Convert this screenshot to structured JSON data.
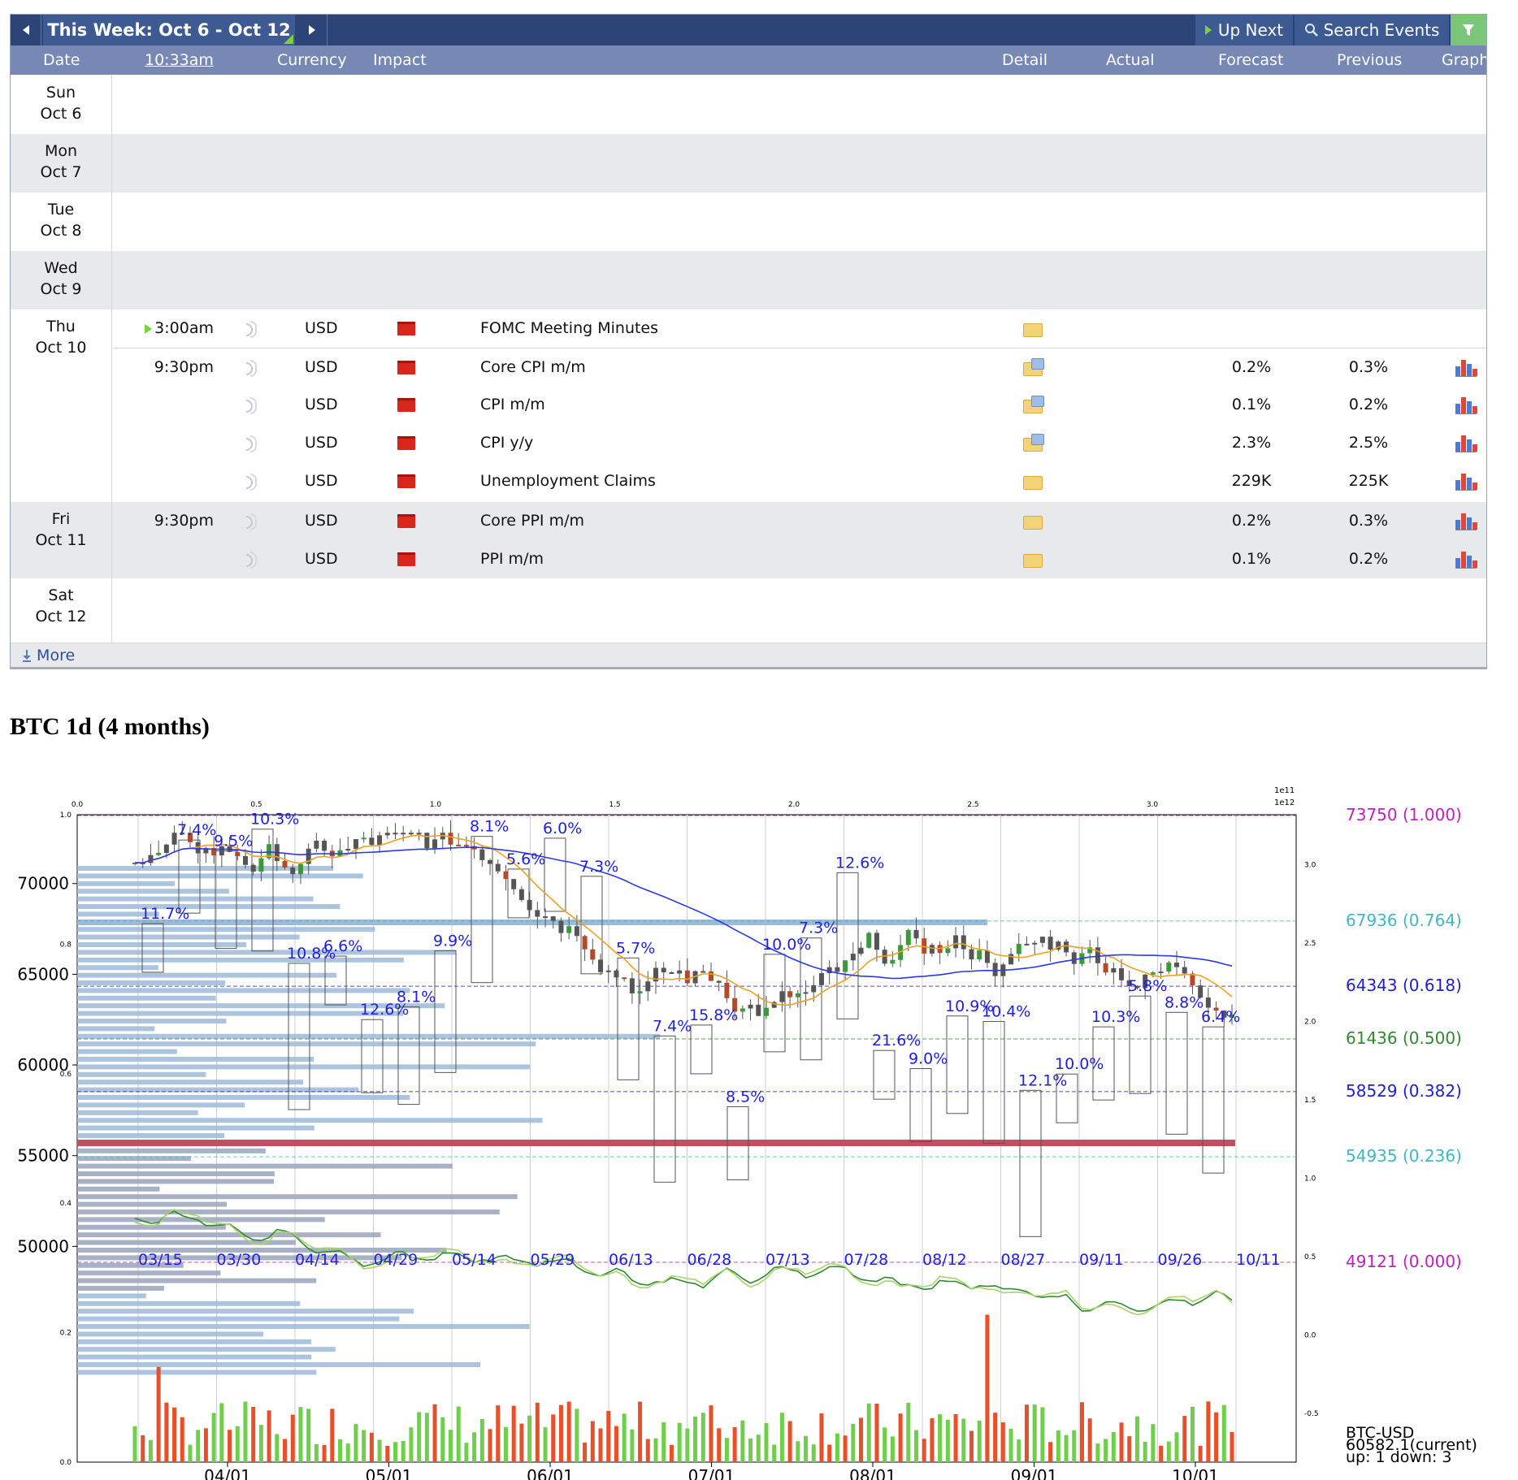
{
  "calendar": {
    "week_label": "This Week: Oct 6 - Oct 12",
    "prev_icon": "caret-left-icon",
    "next_icon": "caret-right-icon",
    "up_next_label": "Up Next",
    "search_label": "Search Events",
    "filter_icon": "filter-icon",
    "columns": {
      "date": "Date",
      "time": "10:33am",
      "currency": "Currency",
      "impact": "Impact",
      "detail": "Detail",
      "actual": "Actual",
      "forecast": "Forecast",
      "previous": "Previous",
      "graph": "Graph"
    },
    "days": [
      {
        "dow": "Sun",
        "date": "Oct 6"
      },
      {
        "dow": "Mon",
        "date": "Oct 7"
      },
      {
        "dow": "Tue",
        "date": "Oct 8"
      },
      {
        "dow": "Wed",
        "date": "Oct 9"
      },
      {
        "dow": "Thu",
        "date": "Oct 10"
      },
      {
        "dow": "Fri",
        "date": "Oct 11"
      },
      {
        "dow": "Sat",
        "date": "Oct 12"
      }
    ],
    "events": [
      {
        "time": "3:00am",
        "currency": "USD",
        "title": "FOMC Meeting Minutes",
        "forecast": "",
        "previous": ""
      },
      {
        "time": "9:30pm",
        "currency": "USD",
        "title": "Core CPI m/m",
        "forecast": "0.2%",
        "previous": "0.3%"
      },
      {
        "time": "",
        "currency": "USD",
        "title": "CPI m/m",
        "forecast": "0.1%",
        "previous": "0.2%"
      },
      {
        "time": "",
        "currency": "USD",
        "title": "CPI y/y",
        "forecast": "2.3%",
        "previous": "2.5%"
      },
      {
        "time": "",
        "currency": "USD",
        "title": "Unemployment Claims",
        "forecast": "229K",
        "previous": "225K"
      },
      {
        "time": "9:30pm",
        "currency": "USD",
        "title": "Core PPI m/m",
        "forecast": "0.2%",
        "previous": "0.3%"
      },
      {
        "time": "",
        "currency": "USD",
        "title": "PPI m/m",
        "forecast": "0.1%",
        "previous": "0.2%"
      }
    ],
    "more_label": "More"
  },
  "chart_title": "BTC 1d (4 months)",
  "chart_data": {
    "type": "line",
    "title": "BTC 1d (4 months)",
    "ylim": [
      48000,
      74200
    ],
    "y_ticks": [
      "50000",
      "55000",
      "60000",
      "65000",
      "70000"
    ],
    "x_ticks": [
      "04/01",
      "05/01",
      "06/01",
      "07/01",
      "08/01",
      "09/01",
      "10/01"
    ],
    "date_markers": [
      "03/15",
      "03/30",
      "04/14",
      "04/29",
      "05/14",
      "05/29",
      "06/13",
      "06/28",
      "07/13",
      "07/28",
      "08/12",
      "08/27",
      "09/11",
      "09/26",
      "10/11"
    ],
    "top_axis_ticks": [
      "0.0",
      "0.5",
      "1.0",
      "1.5",
      "2.0",
      "2.5",
      "3.0"
    ],
    "top_axis_exponents": [
      "1e11",
      "1e12"
    ],
    "left_aux_ticks": [
      "0.0",
      "0.2",
      "0.4",
      "0.6",
      "0.8",
      "1.0"
    ],
    "right_aux_ticks": [
      "-0.5",
      "0.0",
      "0.5",
      "1.0",
      "1.5",
      "2.0",
      "2.5",
      "3.0"
    ],
    "fib_levels": [
      {
        "label": "73750 (1.000)",
        "price": 73750,
        "color": "#c020c0"
      },
      {
        "label": "67936 (0.764)",
        "price": 67936,
        "color": "#3fb8c0"
      },
      {
        "label": "64343 (0.618)",
        "price": 64343,
        "color": "#2020d0"
      },
      {
        "label": "61436 (0.500)",
        "price": 61436,
        "color": "#2f8a2f"
      },
      {
        "label": "58529 (0.382)",
        "price": 58529,
        "color": "#2020d0"
      },
      {
        "label": "54935 (0.236)",
        "price": 54935,
        "color": "#3fb8c0"
      },
      {
        "label": "49121 (0.000)",
        "price": 49121,
        "color": "#c020c0"
      }
    ],
    "swing_labels": [
      "11.7%",
      "7.4%",
      "9.5%",
      "10.3%",
      "10.8%",
      "6.6%",
      "12.6%",
      "8.1%",
      "9.9%",
      "8.1%",
      "5.6%",
      "6.0%",
      "7.3%",
      "5.7%",
      "7.4%",
      "15.8%",
      "8.5%",
      "10.0%",
      "7.3%",
      "12.6%",
      "21.6%",
      "9.0%",
      "10.9%",
      "10.4%",
      "12.1%",
      "10.0%",
      "10.3%",
      "5.8%",
      "8.8%",
      "6.4%"
    ],
    "swing_prices": [
      67800,
      72400,
      71800,
      73000,
      65600,
      66000,
      62500,
      63200,
      66300,
      72600,
      70800,
      72500,
      70400,
      65900,
      61600,
      62200,
      57700,
      66100,
      67000,
      70600,
      60800,
      59800,
      62700,
      62400,
      58600,
      59500,
      62100,
      63800,
      62900,
      62100
    ],
    "legend": [
      "BTC-USD",
      "60582.1(current)",
      "up: 1 down: 3"
    ],
    "current_price": 60582.1
  }
}
